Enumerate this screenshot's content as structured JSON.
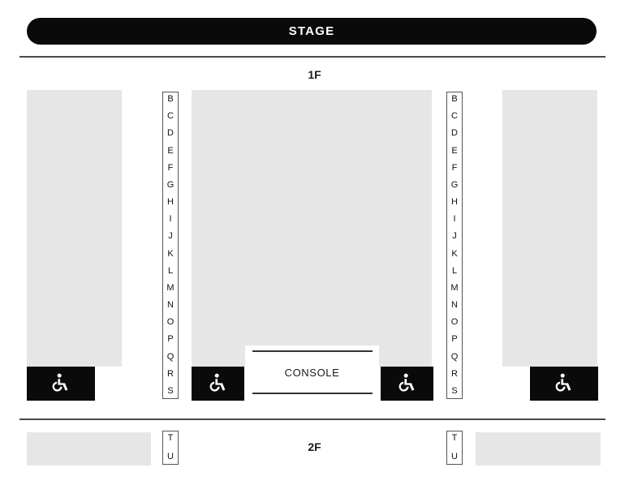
{
  "venue": {
    "stage": {
      "label": "STAGE"
    },
    "floors": [
      {
        "id": "1f",
        "label": "1F"
      },
      {
        "id": "2f",
        "label": "2F"
      }
    ],
    "row_columns": {
      "floor1_left": [
        "B",
        "C",
        "D",
        "E",
        "F",
        "G",
        "H",
        "I",
        "J",
        "K",
        "L",
        "M",
        "N",
        "O",
        "P",
        "Q",
        "R",
        "S"
      ],
      "floor1_right": [
        "B",
        "C",
        "D",
        "E",
        "F",
        "G",
        "H",
        "I",
        "J",
        "K",
        "L",
        "M",
        "N",
        "O",
        "P",
        "Q",
        "R",
        "S"
      ],
      "floor2_left": [
        "T",
        "U"
      ],
      "floor2_right": [
        "T",
        "U"
      ]
    },
    "console": {
      "label": "CONSOLE"
    },
    "accessible_seating": {
      "icon": "wheelchair-icon",
      "count": 4,
      "positions": [
        "left-1f",
        "center-left-1f",
        "center-right-1f",
        "far-right-1f"
      ]
    },
    "colors": {
      "stage_fill": "#0a0a0a",
      "stage_text": "#ffffff",
      "seat_block_fill": "#e6e6e6",
      "divider": "#4a4a4a",
      "accessible_fill": "#0a0a0a",
      "accessible_icon": "#ffffff",
      "page_background": "#ffffff"
    }
  }
}
